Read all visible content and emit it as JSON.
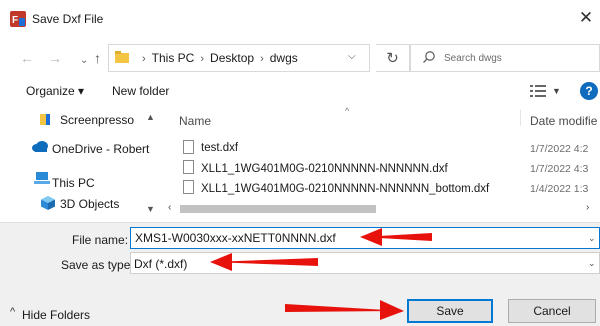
{
  "window": {
    "title": "Save Dxf File",
    "close_glyph": "✕"
  },
  "nav": {
    "back_glyph": "←",
    "forward_glyph": "→",
    "up_glyph": "↑",
    "breadcrumb": [
      "This PC",
      "Desktop",
      "dwgs"
    ],
    "refresh_glyph": "↻",
    "search_placeholder": "Search dwgs"
  },
  "toolbar": {
    "organize_label": "Organize ▾",
    "new_folder_label": "New folder",
    "help_label": "?"
  },
  "sidebar": {
    "items": [
      {
        "label": "Screenpresso",
        "icon": "folder-icon"
      },
      {
        "label": "OneDrive - Robert",
        "icon": "cloud-icon"
      },
      {
        "label": "This PC",
        "icon": "computer-icon"
      },
      {
        "label": "3D Objects",
        "icon": "cube-icon"
      }
    ]
  },
  "file_list": {
    "columns": {
      "name": "Name",
      "date": "Date modifie"
    },
    "files": [
      {
        "name": "test.dxf",
        "date": "1/7/2022 4:2"
      },
      {
        "name": "XLL1_1WG401M0G-0210NNNNN-NNNNNN.dxf",
        "date": "1/7/2022 4:3"
      },
      {
        "name": "XLL1_1WG401M0G-0210NNNNN-NNNNNN_bottom.dxf",
        "date": "1/4/2022 1:3"
      }
    ]
  },
  "form": {
    "filename_label": "File name:",
    "filename_value": "XMS1-W0030xxx-xxNETT0NNNN.dxf",
    "type_label": "Save as type:",
    "type_value": "Dxf (*.dxf)"
  },
  "footer": {
    "hide_folders_label": "Hide Folders",
    "save_label": "Save",
    "cancel_label": "Cancel"
  },
  "colors": {
    "accent": "#0078d4",
    "annotation_arrow": "#e8120c",
    "folder": "#f4c542"
  }
}
